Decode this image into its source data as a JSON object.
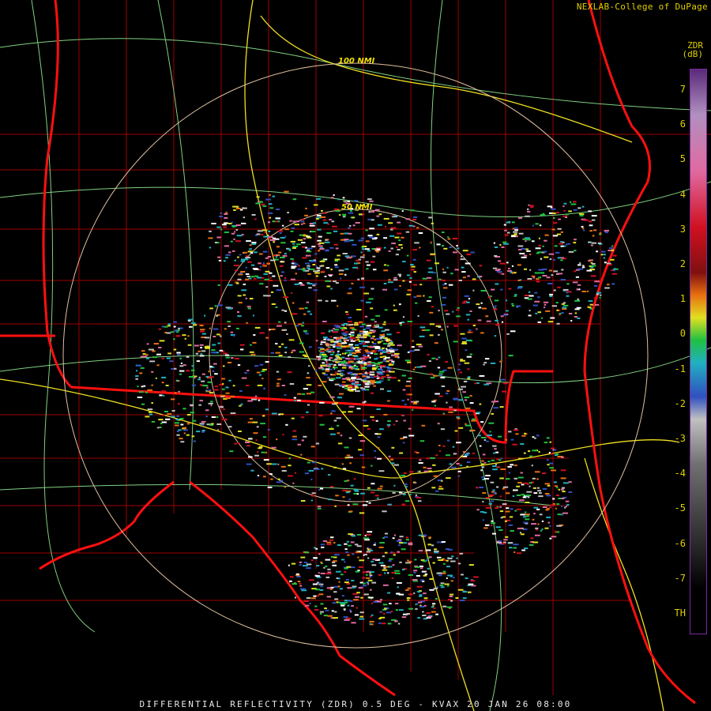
{
  "credit": "NEXLAB-College of DuPage",
  "footer": "DIFFERENTIAL REFLECTIVITY (ZDR) 0.5 DEG - KVAX 20 JAN 26 08:00",
  "legend": {
    "product": "ZDR",
    "unit": "(dB)",
    "ticks": [
      "7",
      "6",
      "5",
      "4",
      "3",
      "2",
      "1",
      "0",
      "-1",
      "-2",
      "-3",
      "-4",
      "-5",
      "-6",
      "-7",
      "TH"
    ],
    "colors": {
      "top": "#5a2a7a",
      "pink": "#e06aa0",
      "red": "#d01020",
      "orange": "#e87010",
      "yellow": "#e0e020",
      "green": "#20c040",
      "cyan": "#20b0c0",
      "blue": "#3050c0",
      "gray": "#c0c0c0",
      "dark": "#202020"
    }
  },
  "rings": {
    "inner_label": "50 NMI",
    "outer_label": "100 NMI"
  },
  "map_colors": {
    "state_border": "#ff1010",
    "county_border": "#a00000",
    "roads": "#80d080",
    "interstate": "#f0e020",
    "range_ring": "#e0c0a0"
  }
}
